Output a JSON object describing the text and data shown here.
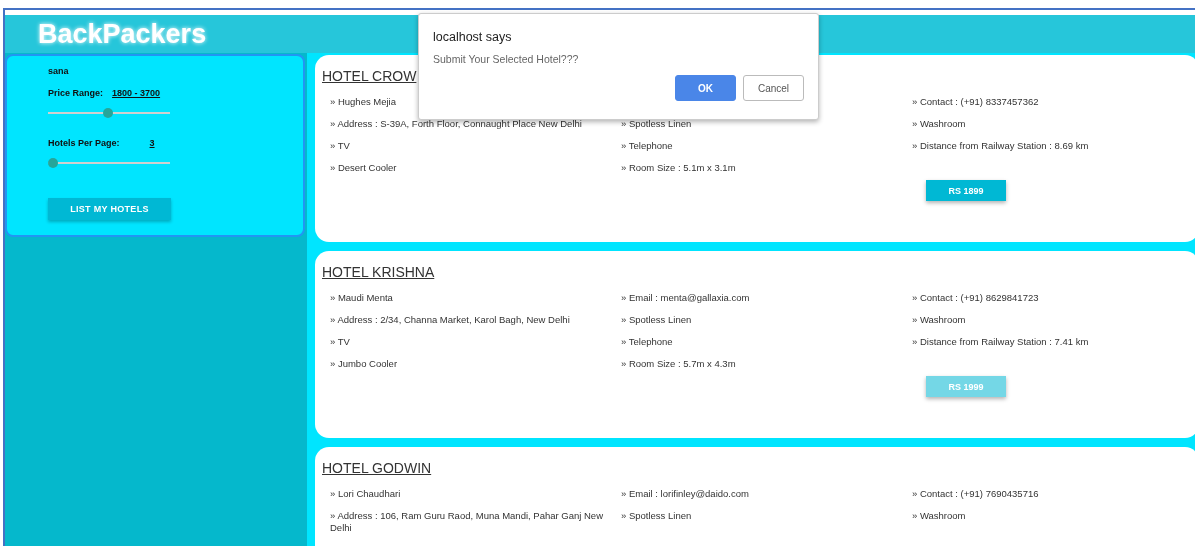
{
  "header": {
    "logo": "BackPackers"
  },
  "sidebar": {
    "user": "sana",
    "filters": [
      {
        "label": "Price Range:",
        "value": "1800 - 3700",
        "level": 0.49
      },
      {
        "label": "Hotels Per Page:",
        "value": "3",
        "level": 0
      }
    ],
    "button": "LIST MY HOTELS"
  },
  "hotels": [
    {
      "title": "HOTEL CROW",
      "rows": [
        {
          "col_1": "» Hughes Mejia",
          "col_3": "» Contact : (+91) 8337457362"
        },
        {
          "col_1": "» Address : S-39A, Forth Floor, Connaught Place New Delhi",
          "col_2": "» Spotless Linen",
          "col_3": "» Washroom"
        },
        {
          "col_1": "» TV",
          "col_2": "» Telephone",
          "col_3": "» Distance from Railway Station : 8.69 km"
        },
        {
          "col_1": "» Desert Cooler",
          "col_2": "» Room Size : 5.1m x 3.1m"
        }
      ],
      "price": "RS 1899",
      "selected": false
    },
    {
      "title": "HOTEL KRISHNA",
      "rows": [
        {
          "col_1": "» Maudi Menta",
          "col_2": "» Email : menta@gallaxia.com",
          "col_3": "» Contact : (+91) 8629841723"
        },
        {
          "col_1": "» Address : 2/34, Channa Market, Karol Bagh, New Delhi",
          "col_2": "» Spotless Linen",
          "col_3": "» Washroom"
        },
        {
          "col_1": "» TV",
          "col_2": "» Telephone",
          "col_3": "» Distance from Railway Station : 7.41 km"
        },
        {
          "col_1": "» Jumbo Cooler",
          "col_2": "» Room Size : 5.7m x 4.3m"
        }
      ],
      "price": "RS 1999",
      "selected": true
    },
    {
      "title": "HOTEL GODWIN",
      "rows": [
        {
          "col_1": "» Lori Chaudhari",
          "col_2": "» Email : lorifinley@daido.com",
          "col_3": "» Contact : (+91) 7690435716"
        },
        {
          "col_1": "» Address : 106, Ram Guru Raod, Muna Mandi, Pahar Ganj New Delhi",
          "col_2": "» Spotless Linen",
          "col_3": "» Washroom"
        }
      ]
    }
  ],
  "dialog": {
    "title": "localhost says",
    "message": "Submit Your Selected Hotel???",
    "buttons": [
      {
        "label": "OK",
        "kind": "primary"
      },
      {
        "label": "Cancel",
        "kind": "secondary"
      }
    ]
  }
}
